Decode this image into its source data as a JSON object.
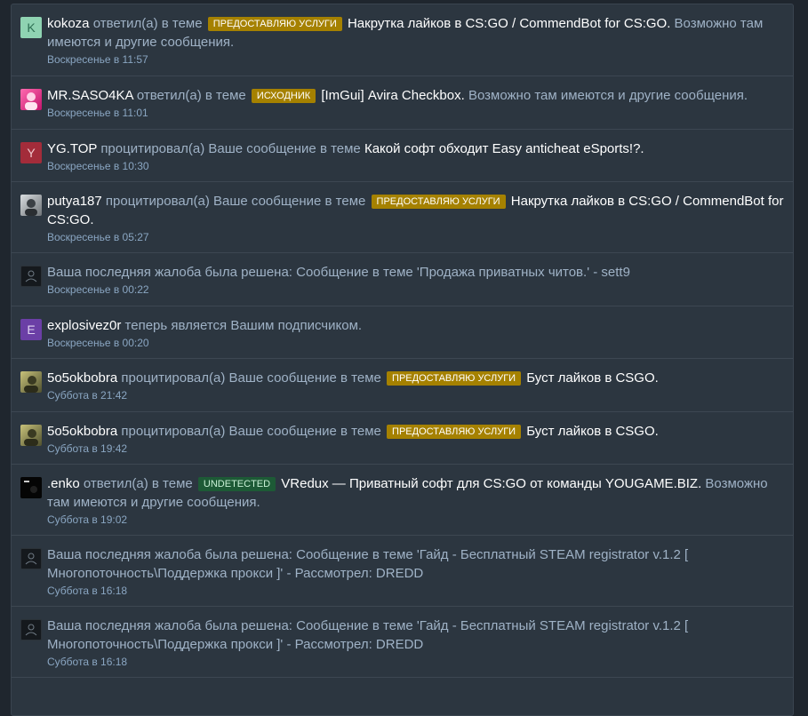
{
  "alerts": [
    {
      "avatar": {
        "type": "letter",
        "letter": "K",
        "color": "#8fd3b2"
      },
      "user": "kokoza",
      "action": "ответил(а) в теме",
      "prefix": "ПРЕДОСТАВЛЯЮ УСЛУГИ",
      "prefix_color": "yellow",
      "topic": "Накрутка лайков в CS:GO / CommendBot for CS:GO.",
      "suffix": "Возможно там имеются и другие сообщения.",
      "time": "Воскресенье в 11:57"
    },
    {
      "avatar": {
        "type": "image",
        "icon": "pink-avatar-icon"
      },
      "user": "MR.SASO4KA",
      "action": "ответил(а) в теме",
      "prefix": "ИСХОДНИК",
      "prefix_color": "yellow",
      "topic": "[ImGui] Avira Checkbox.",
      "suffix": "Возможно там имеются и другие сообщения.",
      "time": "Воскресенье в 11:01"
    },
    {
      "avatar": {
        "type": "letter",
        "letter": "Y",
        "color": "#a32c3a"
      },
      "user": "YG.TOP",
      "action": "процитировал(а) Ваше сообщение в теме",
      "prefix": "",
      "prefix_color": "",
      "topic": "Какой софт обходит Easy anticheat eSports!?.",
      "suffix": "",
      "time": "Воскресенье в 10:30"
    },
    {
      "avatar": {
        "type": "image",
        "icon": "gray-avatar-icon"
      },
      "user": "putya187",
      "action": "процитировал(а) Ваше сообщение в теме",
      "prefix": "ПРЕДОСТАВЛЯЮ УСЛУГИ",
      "prefix_color": "yellow",
      "topic": "Накрутка лайков в CS:GO / CommendBot for CS:GO.",
      "suffix": "",
      "time": "Воскресенье в 05:27"
    },
    {
      "avatar": {
        "type": "image",
        "icon": "system-avatar-icon"
      },
      "user": "",
      "action": "Ваша последняя жалоба была решена: Сообщение в теме 'Продажа приватных читов.' - sett9",
      "prefix": "",
      "prefix_color": "",
      "topic": "",
      "suffix": "",
      "time": "Воскресенье в 00:22"
    },
    {
      "avatar": {
        "type": "letter",
        "letter": "E",
        "color": "#6b3fa6"
      },
      "user": "explosivez0r",
      "action": "теперь является Вашим подписчиком.",
      "prefix": "",
      "prefix_color": "",
      "topic": "",
      "suffix": "",
      "time": "Воскресенье в 00:20"
    },
    {
      "avatar": {
        "type": "image",
        "icon": "olive-avatar-icon"
      },
      "user": "5o5okbobra",
      "action": "процитировал(а) Ваше сообщение в теме",
      "prefix": "ПРЕДОСТАВЛЯЮ УСЛУГИ",
      "prefix_color": "yellow",
      "topic": "Буст лайков в CSGO.",
      "suffix": "",
      "time": "Суббота в 21:42"
    },
    {
      "avatar": {
        "type": "image",
        "icon": "olive-avatar-icon"
      },
      "user": "5o5okbobra",
      "action": "процитировал(а) Ваше сообщение в теме",
      "prefix": "ПРЕДОСТАВЛЯЮ УСЛУГИ",
      "prefix_color": "yellow",
      "topic": "Буст лайков в CSGO.",
      "suffix": "",
      "time": "Суббота в 19:42"
    },
    {
      "avatar": {
        "type": "image",
        "icon": "black-avatar-icon"
      },
      "user": ".enko",
      "action": "ответил(а) в теме",
      "prefix": "UNDETECTED",
      "prefix_color": "green",
      "topic": "VRedux — Приватный софт для CS:GO от команды YOUGAME.BIZ.",
      "suffix": "Возможно там имеются и другие сообщения.",
      "time": "Суббота в 19:02"
    },
    {
      "avatar": {
        "type": "image",
        "icon": "system-avatar-icon"
      },
      "user": "",
      "action": "Ваша последняя жалоба была решена: Сообщение в теме 'Гайд - Бесплатный STEAM registrator v.1.2 [ Многопоточность\\Поддержка прокси ]' - Рассмотрел: DREDD",
      "prefix": "",
      "prefix_color": "",
      "topic": "",
      "suffix": "",
      "time": "Суббота в 16:18"
    },
    {
      "avatar": {
        "type": "image",
        "icon": "system-avatar-icon"
      },
      "user": "",
      "action": "Ваша последняя жалоба была решена: Сообщение в теме 'Гайд - Бесплатный STEAM registrator v.1.2 [ Многопоточность\\Поддержка прокси ]' - Рассмотрел: DREDD",
      "prefix": "",
      "prefix_color": "",
      "topic": "",
      "suffix": "",
      "time": "Суббота в 16:18"
    }
  ],
  "colors": {
    "background": "#1f262e",
    "panel": "#2c3640",
    "link_text": "#9fb2c6",
    "highlight_text": "#ffffff",
    "prefix_yellow": "#a58100",
    "prefix_green": "#1d5a36"
  }
}
